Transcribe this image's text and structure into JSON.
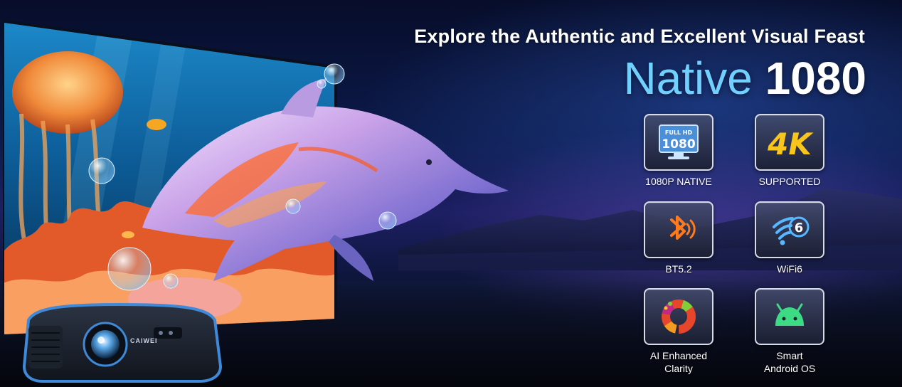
{
  "banner": {
    "tagline": "Explore the Authentic and Excellent Visual Feast",
    "headline_word1": "Native",
    "headline_word2": "1080",
    "projector_brand": "CAIWEI"
  },
  "features": [
    {
      "icon": "full-hd-1080-monitor-icon",
      "icon_text_top": "FULL HD",
      "icon_text_main": "1080",
      "label": "1080P NATIVE"
    },
    {
      "icon": "4k-icon",
      "icon_text_main": "4K",
      "label": "SUPPORTED"
    },
    {
      "icon": "bluetooth-icon",
      "label": "BT5.2"
    },
    {
      "icon": "wifi6-icon",
      "icon_text_main": "6",
      "label": "WiFi6"
    },
    {
      "icon": "ai-color-ring-icon",
      "label_line1": "AI Enhanced",
      "label_line2": "Clarity"
    },
    {
      "icon": "android-icon",
      "label_line1": "Smart",
      "label_line2": "Android OS"
    }
  ],
  "colors": {
    "background_dark": "#070d2a",
    "headline_blue": "#72d0ff",
    "bluetooth_orange": "#ff7a1a",
    "four_k_yellow": "#f7c51c",
    "android_green": "#3ddc84",
    "wifi_blue": "#57b8ff"
  }
}
